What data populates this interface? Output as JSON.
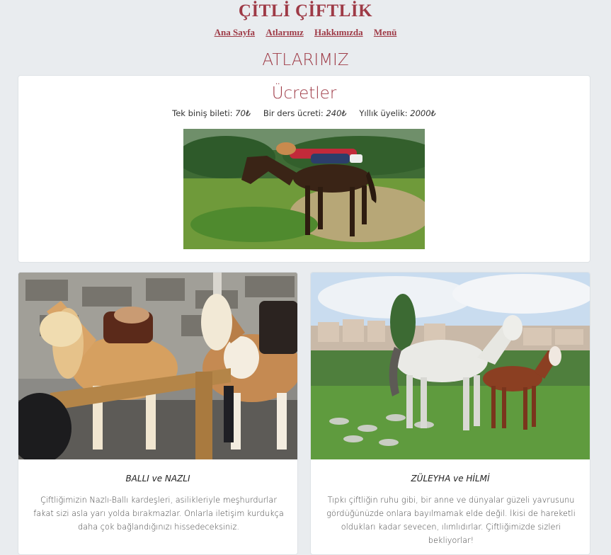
{
  "header": {
    "site_title": "ÇİTLİ ÇİFTLİK",
    "nav": [
      "Ana Sayfa",
      "Atlarımız",
      "Hakkımızda",
      "Menü"
    ]
  },
  "section_title": "ATLARIMIZ",
  "pricing": {
    "title": "Ücretler",
    "items": [
      {
        "label": "Tek biniş bileti:",
        "value": "70₺"
      },
      {
        "label": "Bir ders ücreti:",
        "value": "240₺"
      },
      {
        "label": "Yıllık üyelik:",
        "value": "2000₺"
      }
    ]
  },
  "horses": [
    {
      "name": "BALLI ve NAZLI",
      "description": "Çiftliğimizin Nazlı-Ballı kardeşleri, asilikleriyle meşhurdurlar fakat sizi asla yarı yolda bırakmazlar. Onlarla iletişim kurdukça daha çok bağlandığınızı hissedeceksiniz."
    },
    {
      "name": "ZÜLEYHA ve HİLMİ",
      "description": "Tıpkı çiftliğin ruhu gibi, bir anne ve dünyalar güzeli yavrusunu gördüğünüzde onlara bayılmamak elde değil. İkisi de hareketli oldukları kadar sevecen, ılımlıdırlar. Çiftliğimizde sizleri bekliyorlar!"
    }
  ],
  "colors": {
    "accent": "#9e3a46",
    "background": "#e9ecef",
    "card": "#ffffff"
  }
}
